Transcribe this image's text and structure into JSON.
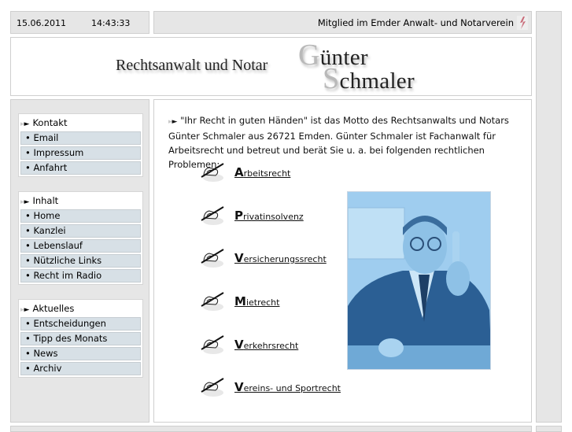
{
  "topbar": {
    "date": "15.06.2011",
    "time": "14:43:33",
    "membership": "Mitglied im Emder Anwalt- und Notarverein",
    "membership_icon": "association-logo-icon"
  },
  "banner": {
    "subtitle": "Rechtsanwalt und Notar",
    "first_name_cap": "G",
    "first_name_rest": "ünter",
    "last_name_cap": "S",
    "last_name_rest": "chmaler"
  },
  "sidebar": {
    "menus": [
      {
        "title": "Kontakt",
        "items": [
          "• Email",
          "• Impressum",
          "• Anfahrt"
        ]
      },
      {
        "title": "Inhalt",
        "items": [
          "• Home",
          "• Kanzlei",
          "• Lebenslauf",
          "• Nützliche Links",
          "• Recht im Radio"
        ]
      },
      {
        "title": "Aktuelles",
        "items": [
          "• Entscheidungen",
          "• Tipp des Monats",
          "• News",
          "• Archiv"
        ]
      }
    ],
    "marker_ghost": "▸",
    "marker": "►"
  },
  "content": {
    "intro": "\"Ihr Recht in guten Händen\" ist das Motto des Rechtsanwalts und Notars Günter Schmaler aus 26721 Emden. Günter Schmaler ist Fachanwalt für Arbeitsrecht und betreut und berät Sie u. a. bei folgenden rechtlichen Problemen:",
    "practice_areas": [
      {
        "cap": "A",
        "rest": "rbeitsrecht"
      },
      {
        "cap": "P",
        "rest": "rivatinsolvenz"
      },
      {
        "cap": "V",
        "rest": "ersicherungssrecht"
      },
      {
        "cap": "M",
        "rest": "ietrecht"
      },
      {
        "cap": "V",
        "rest": "erkehrsrecht"
      },
      {
        "cap": "V",
        "rest": "ereins- und Sportrecht"
      }
    ],
    "portrait_alt": "Portrait of Günter Schmaler"
  },
  "colors": {
    "panel_grey": "#e6e6e6",
    "menu_item_bg": "#d7e0e6",
    "portrait_tint": "#5b9fd3"
  }
}
